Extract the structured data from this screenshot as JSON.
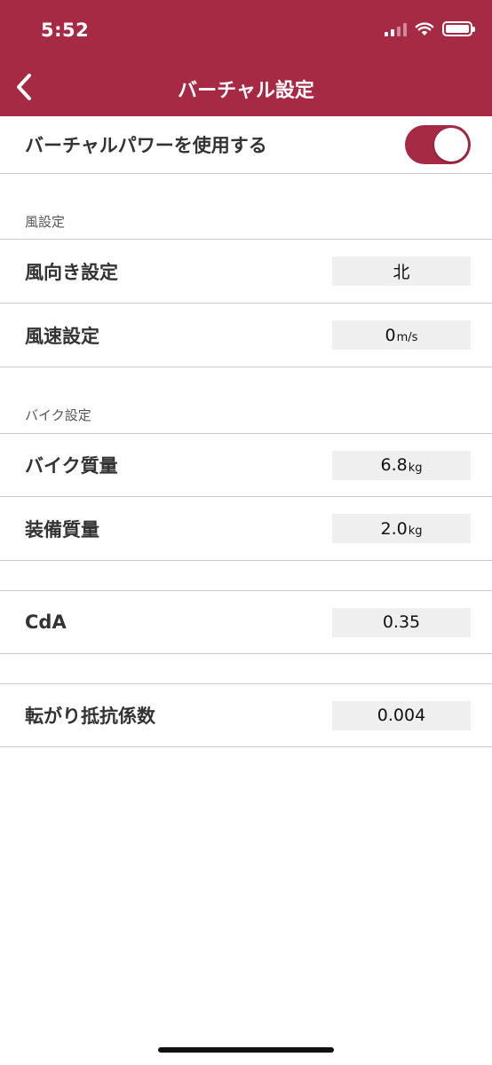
{
  "status_bar": {
    "time": "5:52"
  },
  "nav": {
    "title": "バーチャル設定"
  },
  "virtual_power": {
    "label": "バーチャルパワーを使用する",
    "enabled": true
  },
  "wind_section": {
    "title": "風設定",
    "direction": {
      "label": "風向き設定",
      "value": "北"
    },
    "speed": {
      "label": "風速設定",
      "value": "0",
      "unit": "m/s"
    }
  },
  "bike_section": {
    "title": "バイク設定",
    "bike_mass": {
      "label": "バイク質量",
      "value": "6.8",
      "unit": "kg"
    },
    "equipment_mass": {
      "label": "装備質量",
      "value": "2.0",
      "unit": "kg"
    }
  },
  "cda": {
    "label": "CdA",
    "value": "0.35"
  },
  "rolling_resistance": {
    "label": "転がり抵抗係数",
    "value": "0.004"
  },
  "colors": {
    "accent": "#a72a45"
  }
}
